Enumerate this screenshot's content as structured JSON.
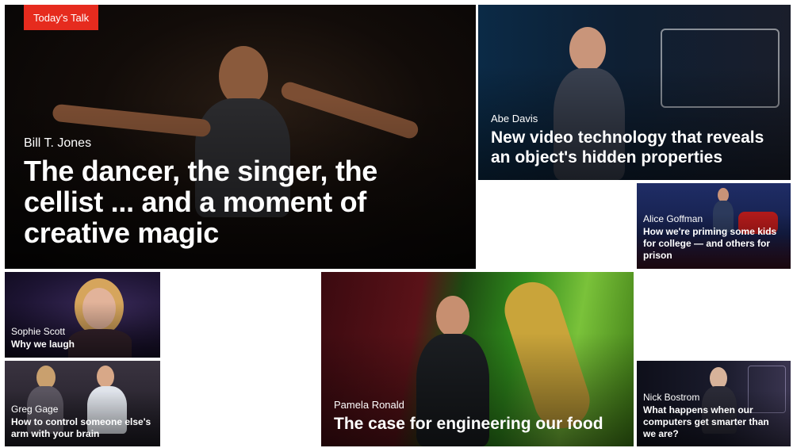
{
  "badge": {
    "label": "Today's Talk",
    "color": "#e62b1e"
  },
  "talks": {
    "featured": {
      "speaker": "Bill T. Jones",
      "title": "The dancer, the singer, the cellist ... and a moment of creative magic"
    },
    "abe": {
      "speaker": "Abe Davis",
      "title": "New video technology that reveals an object's hidden properties"
    },
    "alice": {
      "speaker": "Alice Goffman",
      "title": "How we're priming some kids for college — and others for prison"
    },
    "sophie": {
      "speaker": "Sophie Scott",
      "title": "Why we laugh"
    },
    "greg": {
      "speaker": "Greg Gage",
      "title": "How to control someone else's arm with your brain"
    },
    "pamela": {
      "speaker": "Pamela Ronald",
      "title": "The case for engineering our food"
    },
    "nick": {
      "speaker": "Nick Bostrom",
      "title": "What happens when our computers get smarter than we are?"
    }
  }
}
